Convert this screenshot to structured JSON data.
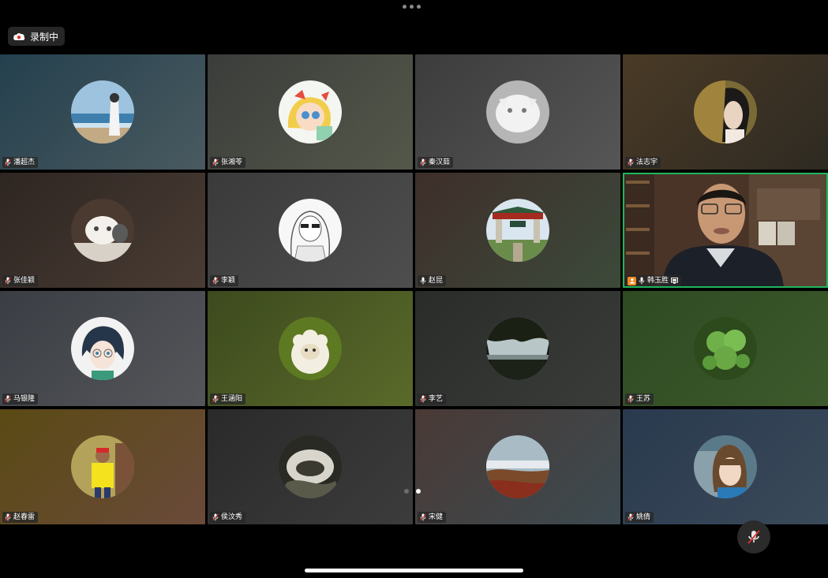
{
  "recording": {
    "label": "录制中",
    "icon": "cloud-record-icon"
  },
  "participants": [
    {
      "name": "潘超杰",
      "bg": [
        "#24404e",
        "#4a5a60"
      ],
      "avatar": "seascape",
      "muted": true
    },
    {
      "name": "张湘苓",
      "bg": [
        "#3a3d3a",
        "#54584a"
      ],
      "avatar": "cartoon-girl",
      "muted": true
    },
    {
      "name": "秦汉茹",
      "bg": [
        "#3c3c3c",
        "#565656"
      ],
      "avatar": "white-cat",
      "muted": true
    },
    {
      "name": "法志宇",
      "bg": [
        "#4a3a26",
        "#2e2a22"
      ],
      "avatar": "woman-portrait",
      "muted": true
    },
    {
      "name": "张佳颖",
      "bg": [
        "#2e2622",
        "#4a3c34"
      ],
      "avatar": "cat-photo",
      "muted": true
    },
    {
      "name": "李颖",
      "bg": [
        "#3a3a3a",
        "#4e4e4e"
      ],
      "avatar": "sketch-girl",
      "muted": true
    },
    {
      "name": "赵昆",
      "bg": [
        "#3e2e2a",
        "#3c4a3a"
      ],
      "avatar": "gate-building",
      "muted": false
    },
    {
      "name": "韩玉胜",
      "bg": [
        "#3a2a22",
        "#5a4638"
      ],
      "avatar": "video-feed",
      "muted": false,
      "active": true,
      "host": true,
      "sharing": true
    },
    {
      "name": "马银隆",
      "bg": [
        "#3a3e44",
        "#55565a"
      ],
      "avatar": "anime-boy",
      "muted": true
    },
    {
      "name": "王涵阳",
      "bg": [
        "#3c4a1e",
        "#5a6a2a"
      ],
      "avatar": "plush-sheep",
      "muted": true
    },
    {
      "name": "李艺",
      "bg": [
        "#2a2c2a",
        "#3a3c3a"
      ],
      "avatar": "tree-silhouette",
      "muted": true
    },
    {
      "name": "王苏",
      "bg": [
        "#2e4a22",
        "#3c5a2c"
      ],
      "avatar": "clover-leaf",
      "muted": true
    },
    {
      "name": "赵春雷",
      "bg": [
        "#5a4a14",
        "#6a4a3a"
      ],
      "avatar": "man-yellow-shirt",
      "muted": true
    },
    {
      "name": "侯汶秀",
      "bg": [
        "#2a2a2a",
        "#3c3c3c"
      ],
      "avatar": "water-photo",
      "muted": true
    },
    {
      "name": "宋健",
      "bg": [
        "#4a3a36",
        "#3c4a50"
      ],
      "avatar": "landscape",
      "muted": true
    },
    {
      "name": "姚倩",
      "bg": [
        "#2a3a4e",
        "#3a4a5a"
      ],
      "avatar": "woman-bangs",
      "muted": true
    }
  ],
  "pager": {
    "current": 2,
    "total": 2
  },
  "controls": {
    "mic_icon": "mic-muted-icon"
  },
  "colors": {
    "active_border": "#1fb55c",
    "host_badge": "#f08a24"
  }
}
